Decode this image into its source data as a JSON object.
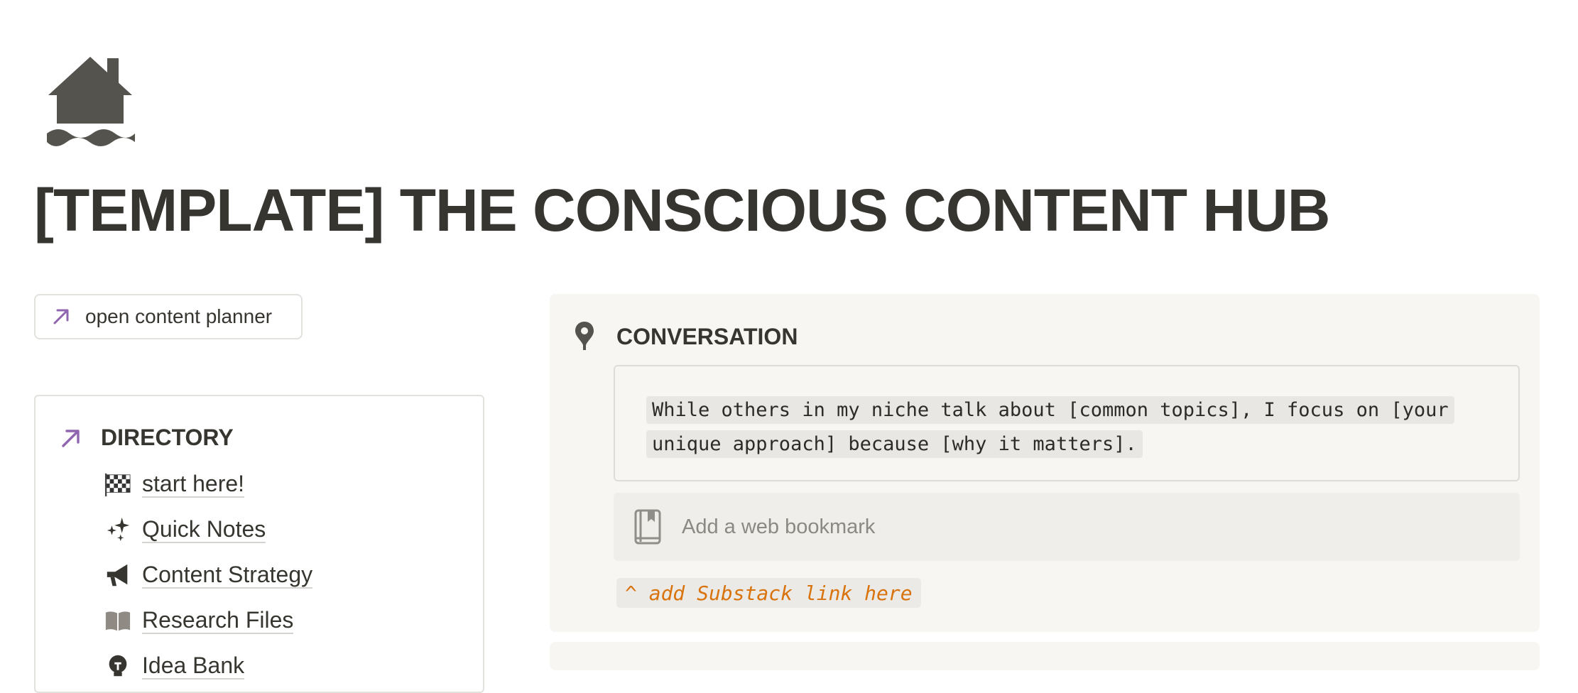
{
  "page": {
    "title": "[TEMPLATE] THE CONSCIOUS CONTENT HUB",
    "icon": "house-flood-icon"
  },
  "open_button": {
    "label": "open content planner",
    "icon": "arrow-up-right-icon"
  },
  "directory": {
    "title": "DIRECTORY",
    "icon": "arrow-up-right-icon",
    "items": [
      {
        "label": "start here!",
        "icon": "checkered-flag-icon"
      },
      {
        "label": "Quick Notes",
        "icon": "sparkles-icon"
      },
      {
        "label": "Content Strategy",
        "icon": "megaphone-icon"
      },
      {
        "label": "Research Files",
        "icon": "open-book-icon"
      },
      {
        "label": "Idea Bank",
        "icon": "lightbulb-icon"
      }
    ]
  },
  "callout": {
    "title": "CONVERSATION",
    "icon": "map-pin-icon",
    "quote": "While others in my niche talk about [common topics], I focus on [your unique approach] because [why it matters].",
    "bookmark_placeholder": "Add a web bookmark",
    "bookmark_icon": "bookmark-book-icon",
    "note": "^ add Substack link here"
  },
  "colors": {
    "text": "#37352f",
    "accent_purple": "#9065b0",
    "note_orange": "#d9730d",
    "callout_bg": "#f7f6f3"
  }
}
